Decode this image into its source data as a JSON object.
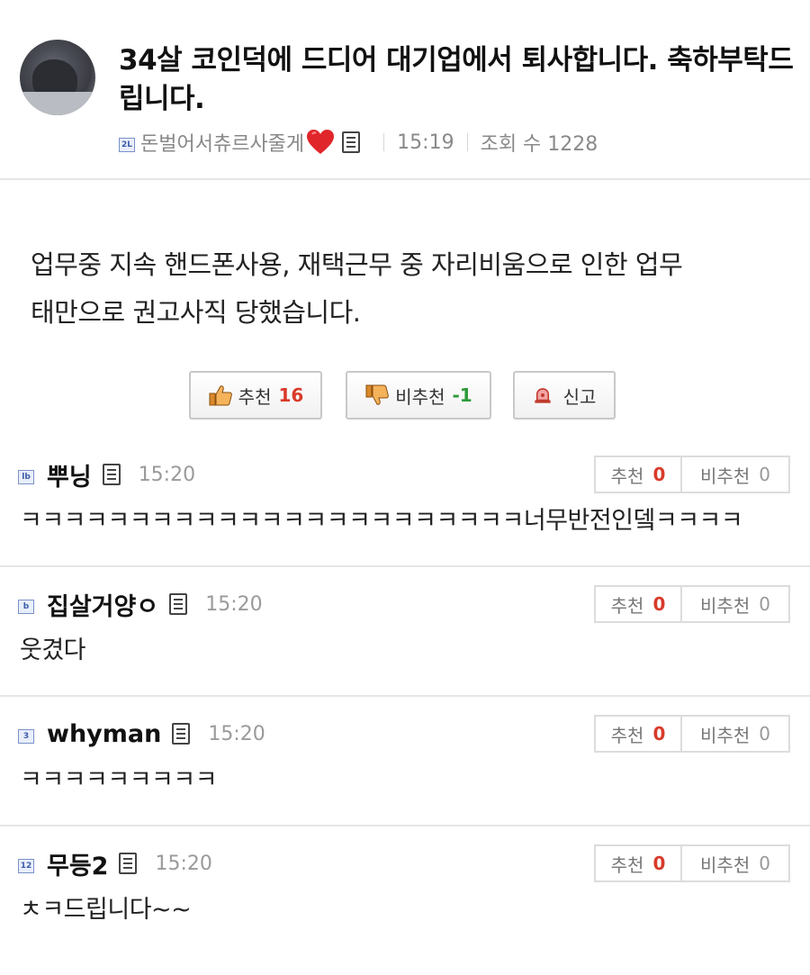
{
  "post": {
    "title": "34살 코인덕에 드디어 대기업에서 퇴사합니다. 축하부탁드립니다.",
    "author_level": "2L",
    "author": "돈벌어서츄르사줄게",
    "time": "15:19",
    "views": "조회 수 1228",
    "body_line1": "업무중 지속 핸드폰사용, 재택근무 중 자리비움으로 인한 업무",
    "body_line2": "태만으로 권고사직 당했습니다."
  },
  "vote_bar": {
    "up_label": "추천",
    "up_count": "16",
    "down_label": "비추천",
    "down_count": "-1",
    "report_label": "신고"
  },
  "comments": [
    {
      "level": "lb",
      "name": "뿌닝",
      "time": "15:20",
      "text": "ㅋㅋㅋㅋㅋㅋㅋㅋㅋㅋㅋㅋㅋㅋㅋㅋㅋㅋㅋㅋㅋㅋㅋ너무반전인뎈ㅋㅋㅋㅋ",
      "up_label": "추천",
      "up": "0",
      "down_label": "비추천",
      "down": "0"
    },
    {
      "level": "b",
      "name": "집살거양ㅇ",
      "time": "15:20",
      "text": "웃겼다",
      "up_label": "추천",
      "up": "0",
      "down_label": "비추천",
      "down": "0"
    },
    {
      "level": "3",
      "name": "whyman",
      "time": "15:20",
      "text": "ㅋㅋㅋㅋㅋㅋㅋㅋㅋ",
      "up_label": "추천",
      "up": "0",
      "down_label": "비추천",
      "down": "0"
    },
    {
      "level": "12",
      "name": "무등2",
      "time": "15:20",
      "text": "ㅊㅋ드립니다~~",
      "up_label": "추천",
      "up": "0",
      "down_label": "비추천",
      "down": "0"
    }
  ],
  "colors": {
    "accent_red": "#d83a2a",
    "accent_green": "#2e9b3a",
    "heart": "#e0262b",
    "border": "#e6e6e6"
  },
  "icons": {
    "avatar": "cat-photo-avatar",
    "level": "level-badge-icon",
    "heart": "heart-icon",
    "memo": "memo-icon",
    "thumbs_up": "thumbs-up-icon",
    "thumbs_down": "thumbs-down-icon",
    "report": "siren-icon"
  }
}
